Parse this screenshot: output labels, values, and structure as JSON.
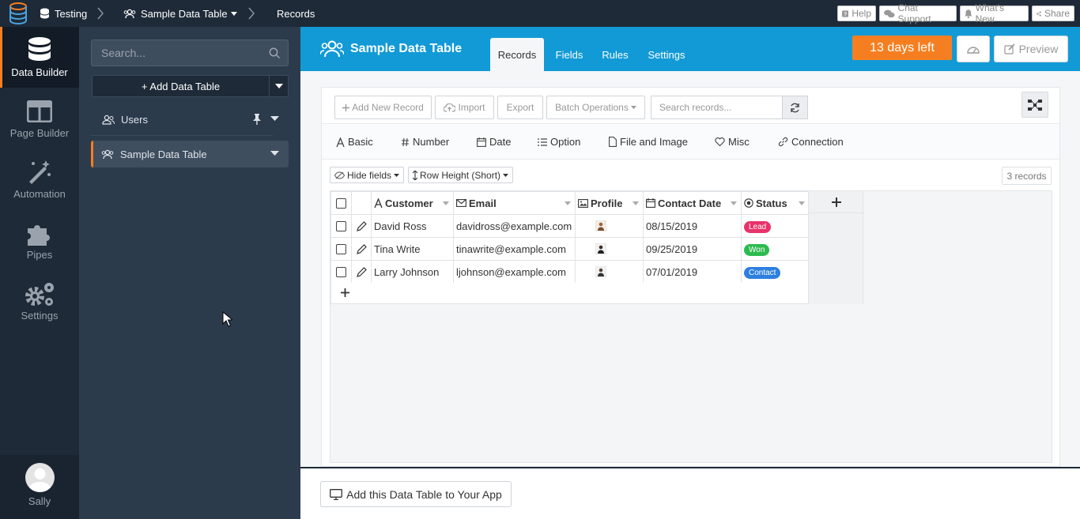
{
  "topbar": {
    "app_icon": "database-logo-icon",
    "breadcrumbs": [
      {
        "label": "Testing",
        "icon": "database-icon"
      },
      {
        "label": "Sample Data Table",
        "icon": "users-icon"
      },
      {
        "label": "Records"
      }
    ],
    "buttons": [
      {
        "label": "Help",
        "icon": "question-icon"
      },
      {
        "label": "Chat Support",
        "icon": "chat-icon"
      },
      {
        "label": "What's New",
        "icon": "bell-icon"
      },
      {
        "label": "Share",
        "icon": "share-icon"
      }
    ]
  },
  "rail": {
    "items": [
      {
        "label": "Data Builder",
        "icon": "database-icon",
        "active": true
      },
      {
        "label": "Page Builder",
        "icon": "layout-icon"
      },
      {
        "label": "Automation",
        "icon": "magic-wand-icon"
      },
      {
        "label": "Pipes",
        "icon": "puzzle-icon"
      },
      {
        "label": "Settings",
        "icon": "gears-icon"
      }
    ],
    "user": {
      "name": "Sally"
    }
  },
  "panel": {
    "search_placeholder": "Search...",
    "add_table_label": "+ Add Data Table",
    "tables": [
      {
        "label": "Users",
        "pinned": true
      },
      {
        "label": "Sample Data Table",
        "selected": true
      }
    ]
  },
  "header": {
    "title": "Sample Data Table",
    "tabs": [
      "Records",
      "Fields",
      "Rules",
      "Settings"
    ],
    "active_tab": "Records",
    "trial": "13 days left",
    "preview_label": "Preview",
    "accent": "#129ad6",
    "orange": "#f57f20"
  },
  "toolbar": {
    "add_record": "Add New Record",
    "import": "Import",
    "export": "Export",
    "batch": "Batch Operations",
    "search_placeholder": "Search records..."
  },
  "field_types": [
    {
      "label": "Basic",
      "icon": "text-icon"
    },
    {
      "label": "Number",
      "icon": "hash-icon"
    },
    {
      "label": "Date",
      "icon": "calendar-icon"
    },
    {
      "label": "Option",
      "icon": "list-icon"
    },
    {
      "label": "File and Image",
      "icon": "file-icon"
    },
    {
      "label": "Misc",
      "icon": "heart-icon"
    },
    {
      "label": "Connection",
      "icon": "link-icon"
    }
  ],
  "view": {
    "hide_fields": "Hide fields",
    "row_height": "Row Height (Short)",
    "record_count": "3 records"
  },
  "table": {
    "columns": [
      "Customer",
      "Email",
      "Profile",
      "Contact Date",
      "Status"
    ],
    "rows": [
      {
        "customer": "David Ross",
        "email": "davidross@example.com",
        "date": "08/15/2019",
        "status": "Lead",
        "status_color": "#e8336b"
      },
      {
        "customer": "Tina Write",
        "email": "tinawrite@example.com",
        "date": "09/25/2019",
        "status": "Won",
        "status_color": "#2dbb4e"
      },
      {
        "customer": "Larry Johnson",
        "email": "ljohnson@example.com",
        "date": "07/01/2019",
        "status": "Contact",
        "status_color": "#2d7fe0"
      }
    ]
  },
  "footer": {
    "add_to_app": "Add this Data Table to Your App"
  }
}
